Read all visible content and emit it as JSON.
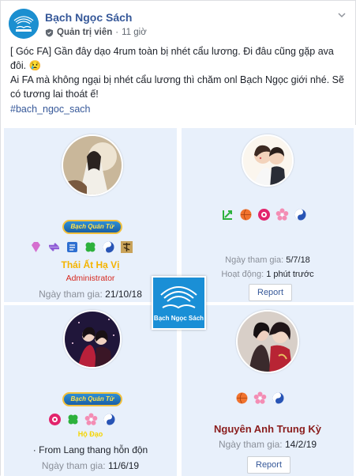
{
  "header": {
    "page_name": "Bạch Ngọc Sách",
    "role": "Quản trị viên",
    "separator": "·",
    "time": "11 giờ",
    "logo_icon": "book-logo-icon",
    "options_icon": "chevron-down-icon"
  },
  "post": {
    "line1": "[ Góc FA] Gần đây dạo 4rum toàn bị nhét cẩu lương. Đi đâu cũng gặp ava đôi. 😢",
    "line2": "Ai FA mà không ngại bị nhét cẩu lương thì chăm onl Bạch Ngọc giới nhé. Sẽ có tương lai thoát ế!",
    "hashtag": "#bach_ngoc_sach"
  },
  "cards": [
    {
      "banner": "Bạch Quán Tử",
      "name": "Thái Ất Hạ Vị",
      "title": "Administrator",
      "joined_label": "Ngày tham gia:",
      "joined": "21/10/18",
      "badges": [
        "gem-icon",
        "arrows-icon",
        "book-icon",
        "clover-icon",
        "yin-yang-icon",
        "kanji-icon"
      ]
    },
    {
      "joined_label": "Ngày tham gia:",
      "joined": "5/7/18",
      "activity_label": "Hoạt động:",
      "activity": "1 phút trước",
      "report": "Report",
      "badges": [
        "chart-icon",
        "ball-icon",
        "lotus-icon",
        "sakura-icon",
        "yin-yang-icon"
      ]
    },
    {
      "banner": "Bạch Quán Tử",
      "role": "Hộ Đạo",
      "from": "· From Lang thang hỗn độn",
      "joined_label": "Ngày tham gia:",
      "joined": "11/6/19",
      "badges": [
        "lotus-icon",
        "clover-icon",
        "sakura-icon",
        "yin-yang-icon"
      ]
    },
    {
      "name": "Nguyên Anh Trung Kỳ",
      "joined_label": "Ngày tham gia:",
      "joined": "14/2/19",
      "report": "Report",
      "badges": [
        "ball-icon",
        "sakura-icon",
        "yin-yang-icon"
      ]
    }
  ],
  "watermark": {
    "text": "Bạch Ngọc Sách"
  },
  "colors": {
    "link": "#365899",
    "admin_name": "#f5b400",
    "admin_title": "#d6281f",
    "member_name": "#8a1d1d",
    "cell_bg": "#e8f0fb",
    "logo_blue": "#1a8fd6"
  }
}
